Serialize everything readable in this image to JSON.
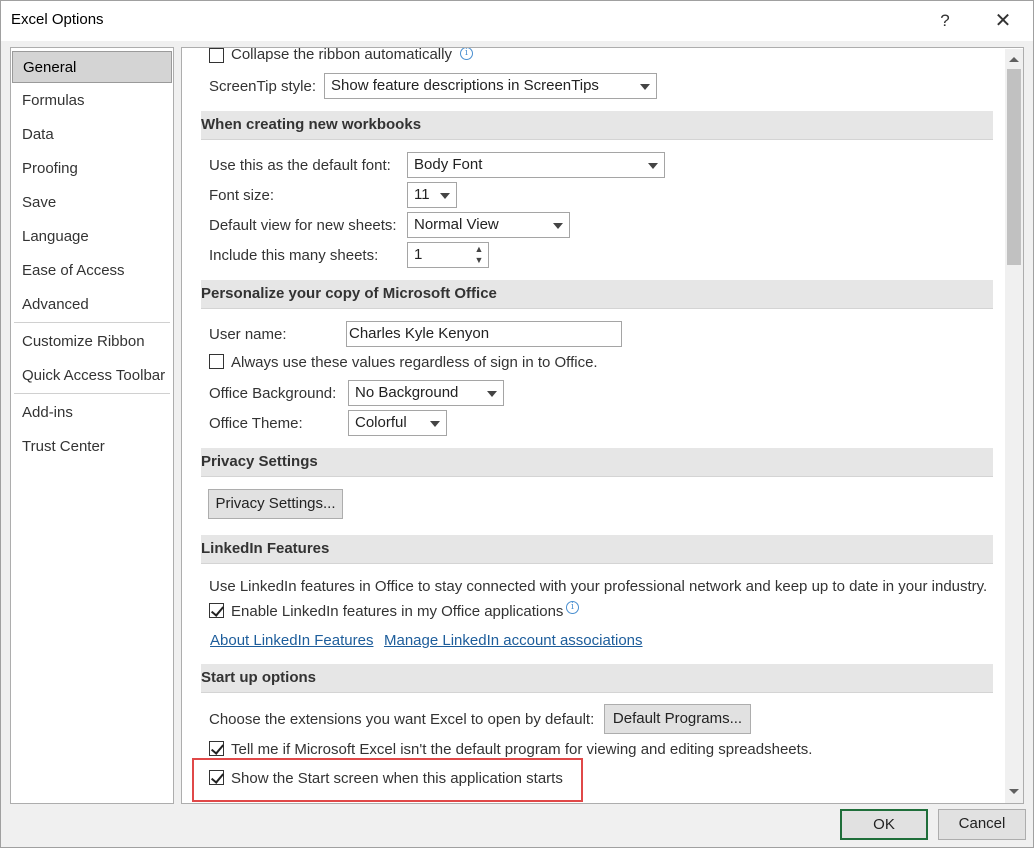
{
  "window": {
    "title": "Excel Options",
    "help_label": "?",
    "close_label": "✕"
  },
  "nav": {
    "items": [
      {
        "label": "General",
        "selected": true
      },
      {
        "label": "Formulas"
      },
      {
        "label": "Data"
      },
      {
        "label": "Proofing"
      },
      {
        "label": "Save"
      },
      {
        "label": "Language"
      },
      {
        "label": "Ease of Access"
      },
      {
        "label": "Advanced"
      },
      {
        "label": "Customize Ribbon"
      },
      {
        "label": "Quick Access Toolbar"
      },
      {
        "label": "Add-ins"
      },
      {
        "label": "Trust Center"
      }
    ]
  },
  "ui_options": {
    "collapse_ribbon_label": "Collapse the ribbon automatically",
    "collapse_ribbon_checked": false,
    "screentip_label": "ScreenTip style:",
    "screentip_value": "Show feature descriptions in ScreenTips"
  },
  "new_workbooks": {
    "header": "When creating new workbooks",
    "font_label": "Use this as the default font:",
    "font_value": "Body Font",
    "size_label": "Font size:",
    "size_value": "11",
    "view_label": "Default view for new sheets:",
    "view_value": "Normal View",
    "sheets_label": "Include this many sheets:",
    "sheets_value": "1"
  },
  "personalize": {
    "header": "Personalize your copy of Microsoft Office",
    "username_label": "User name:",
    "username_value": "Charles Kyle Kenyon",
    "always_use_label": "Always use these values regardless of sign in to Office.",
    "always_use_checked": false,
    "background_label": "Office Background:",
    "background_value": "No Background",
    "theme_label": "Office Theme:",
    "theme_value": "Colorful"
  },
  "privacy": {
    "header": "Privacy Settings",
    "button_label": "Privacy Settings..."
  },
  "linkedin": {
    "header": "LinkedIn Features",
    "description": "Use LinkedIn features in Office to stay connected with your professional network and keep up to date in your industry.",
    "enable_label": "Enable LinkedIn features in my Office applications",
    "enable_checked": true,
    "about_link": "About LinkedIn Features",
    "manage_link": "Manage LinkedIn account associations"
  },
  "startup": {
    "header": "Start up options",
    "extensions_label": "Choose the extensions you want Excel to open by default:",
    "default_programs_label": "Default Programs...",
    "tell_me_label": "Tell me if Microsoft Excel isn't the default program for viewing and editing spreadsheets.",
    "tell_me_checked": true,
    "show_start_label": "Show the Start screen when this application starts",
    "show_start_checked": true
  },
  "footer": {
    "ok_label": "OK",
    "cancel_label": "Cancel"
  },
  "colors": {
    "highlight": "#e04848",
    "ok_border": "#1f6e3a",
    "link": "#1d5d9b"
  }
}
